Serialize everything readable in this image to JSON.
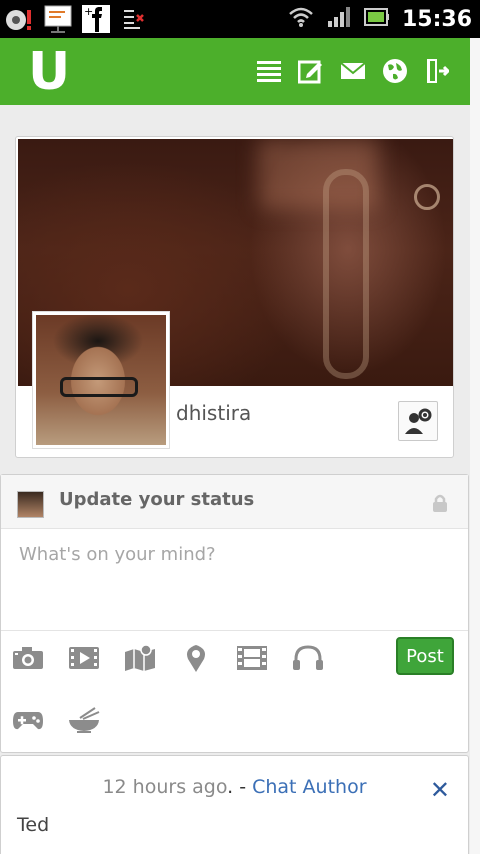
{
  "status_bar": {
    "time": "15:36",
    "notification_icons": [
      "alert-notification-icon",
      "presentation-notification-icon",
      "facebook-notification-icon",
      "task-list-notification-icon"
    ],
    "system_icons": [
      "wifi-icon",
      "signal-icon",
      "battery-icon"
    ]
  },
  "app": {
    "logo": "U",
    "brand_color": "#4caf2b",
    "nav_icons": [
      "list-icon",
      "compose-icon",
      "mail-icon",
      "globe-icon",
      "logout-icon"
    ]
  },
  "profile": {
    "username": "dhistira"
  },
  "composer": {
    "title": "Update your status",
    "placeholder": "What's on your mind?",
    "post_label": "Post",
    "tool_icons": [
      "camera-icon",
      "video-icon",
      "map-icon",
      "location-pin-icon",
      "film-icon",
      "headphones-icon",
      "gamepad-icon",
      "food-bowl-icon"
    ]
  },
  "feed": [
    {
      "time": "12 hours ago",
      "separator": ". - ",
      "author": "Chat Author",
      "text": "Ted",
      "close": "✕"
    }
  ]
}
